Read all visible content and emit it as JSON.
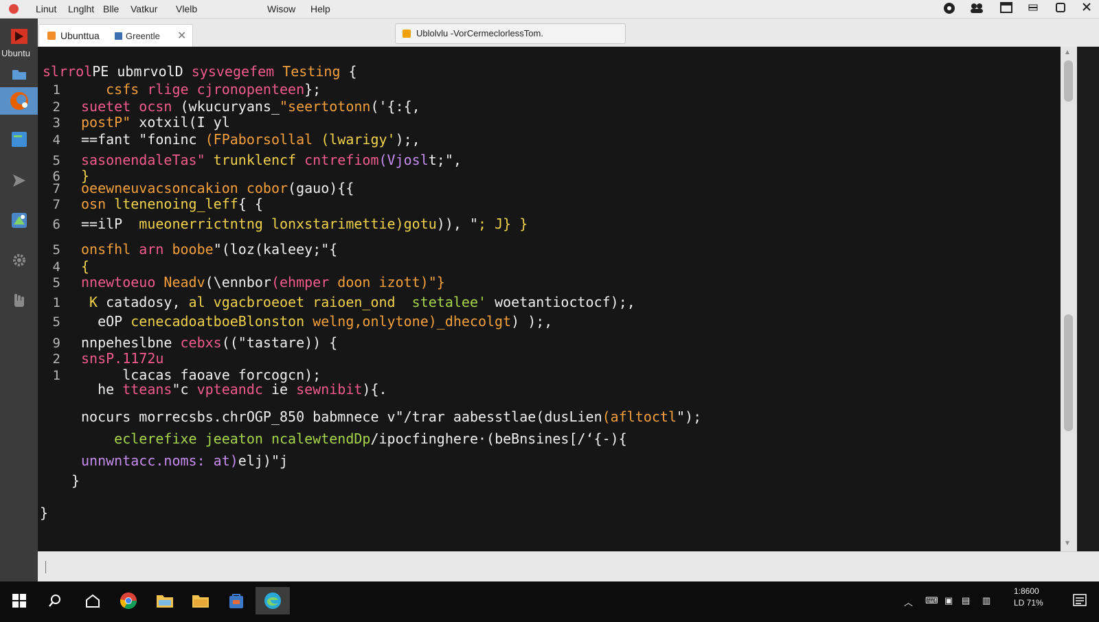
{
  "menubar": {
    "items": [
      "Linut",
      "Lnglht",
      "Blle",
      "Vatkur",
      "Vlelb",
      "Wisow",
      "Help"
    ]
  },
  "sidebar": {
    "label": "Ubuntu",
    "items": [
      "ubuntu-logo",
      "files-icon",
      "firefox-icon",
      "document-icon",
      "send-icon",
      "maps-icon",
      "settings-icon",
      "hand-icon"
    ]
  },
  "tabs": {
    "tab1_title": "Ubunttua",
    "tab1_sub": "Greentle",
    "tab2_title": "Ublolvlu -VorCermeclorlessTom."
  },
  "editor": {
    "lines": [
      {
        "num": "",
        "parts": [
          {
            "t": "slrrol",
            "c": "pink"
          },
          {
            "t": "PE ubmrvolD ",
            "c": "white"
          },
          {
            "t": "sysvegefem ",
            "c": "pink"
          },
          {
            "t": "Testing ",
            "c": "orange"
          },
          {
            "t": "{",
            "c": "white"
          }
        ]
      },
      {
        "num": "1",
        "parts": [
          {
            "t": "   ",
            "c": "white"
          },
          {
            "t": "csfs ",
            "c": "orange"
          },
          {
            "t": "rlige ",
            "c": "pink"
          },
          {
            "t": "cjronopenteen",
            "c": "pink"
          },
          {
            "t": "};",
            "c": "white"
          }
        ]
      },
      {
        "num": "2",
        "parts": [
          {
            "t": "suetet ocsn ",
            "c": "pink"
          },
          {
            "t": "(wkucuryans_",
            "c": "white"
          },
          {
            "t": "\"seertotonn",
            "c": "orange"
          },
          {
            "t": "('{:{,",
            "c": "white"
          }
        ]
      },
      {
        "num": "3",
        "parts": [
          {
            "t": "postP\" ",
            "c": "orange"
          },
          {
            "t": "xotxil(I yl",
            "c": "white"
          }
        ]
      },
      {
        "num": "4",
        "parts": [
          {
            "t": "==fant ",
            "c": "white"
          },
          {
            "t": "\"foninc ",
            "c": "white"
          },
          {
            "t": "(FPaborsollal ",
            "c": "orange"
          },
          {
            "t": "(lwarigy'",
            "c": "yellow"
          },
          {
            "t": ");,",
            "c": "white"
          }
        ]
      },
      {
        "num": "5",
        "parts": [
          {
            "t": "sasonendaleTas\" ",
            "c": "pink"
          },
          {
            "t": "trunklencf ",
            "c": "yellow"
          },
          {
            "t": "cntrefiom",
            "c": "pink"
          },
          {
            "t": "(Vjosl",
            "c": "violet"
          },
          {
            "t": "t;\",",
            "c": "white"
          }
        ]
      },
      {
        "num": "6",
        "parts": [
          {
            "t": "}",
            "c": "yellow"
          }
        ]
      },
      {
        "num": "7",
        "parts": [
          {
            "t": "oeewneuvacsoncakion ",
            "c": "orange"
          },
          {
            "t": "cobor",
            "c": "orange"
          },
          {
            "t": "(gauo){{",
            "c": "white"
          }
        ]
      },
      {
        "num": "7",
        "parts": [
          {
            "t": "osn ",
            "c": "orange"
          },
          {
            "t": "ltenenoing_leff",
            "c": "yellow"
          },
          {
            "t": "{ {",
            "c": "white"
          }
        ]
      },
      {
        "num": "6",
        "parts": [
          {
            "t": "==ilP  ",
            "c": "white"
          },
          {
            "t": "mueonerrictntng ",
            "c": "yellow"
          },
          {
            "t": "lonxstarimettie)gotu",
            "c": "yellow"
          },
          {
            "t": ")), \"",
            "c": "white"
          },
          {
            "t": "; J} }",
            "c": "yellow"
          }
        ]
      },
      {
        "num": "5",
        "parts": [
          {
            "t": "onsfhl ",
            "c": "orange"
          },
          {
            "t": "arn ",
            "c": "pink"
          },
          {
            "t": "boobe",
            "c": "orange"
          },
          {
            "t": "\"(loz(kaleey",
            "c": "white"
          },
          {
            "t": ";\"{",
            "c": "white"
          }
        ]
      },
      {
        "num": "4",
        "parts": [
          {
            "t": "{",
            "c": "yellow"
          }
        ]
      },
      {
        "num": "5",
        "parts": [
          {
            "t": "nnewtoeuo ",
            "c": "pink"
          },
          {
            "t": "Neadv",
            "c": "orange"
          },
          {
            "t": "(\\ennbor",
            "c": "white"
          },
          {
            "t": "(ehmper ",
            "c": "pink"
          },
          {
            "t": "doon izott)\"}",
            "c": "orange"
          }
        ]
      },
      {
        "num": "1",
        "parts": [
          {
            "t": " K ",
            "c": "yellow"
          },
          {
            "t": "catadosy, ",
            "c": "white"
          },
          {
            "t": "al vgacbroeoet ",
            "c": "yellow"
          },
          {
            "t": "raioen_ond  ",
            "c": "yellow"
          },
          {
            "t": "stetalee' ",
            "c": "green"
          },
          {
            "t": "woetantioctocf);,",
            "c": "white"
          }
        ]
      },
      {
        "num": "5",
        "parts": [
          {
            "t": "  eOP ",
            "c": "white"
          },
          {
            "t": "cenecadoatboeBlonston ",
            "c": "yellow"
          },
          {
            "t": "welng,onlytone)_dhecolgt",
            "c": "orange"
          },
          {
            "t": ") );,",
            "c": "white"
          }
        ]
      },
      {
        "num": "9",
        "parts": [
          {
            "t": "nnpeheslbne ",
            "c": "white"
          },
          {
            "t": "cebxs",
            "c": "pink"
          },
          {
            "t": "((\"tastare)) {",
            "c": "white"
          }
        ]
      },
      {
        "num": "2",
        "parts": [
          {
            "t": "snsP.1172u",
            "c": "pink"
          }
        ]
      },
      {
        "num": "1",
        "parts": [
          {
            "t": "     lcacas faoave forcogcn);",
            "c": "white"
          }
        ]
      },
      {
        "num": "",
        "parts": [
          {
            "t": "  he ",
            "c": "white"
          },
          {
            "t": "tteans",
            "c": "pink"
          },
          {
            "t": "\"c ",
            "c": "white"
          },
          {
            "t": "vpteandc ",
            "c": "pink"
          },
          {
            "t": "ie ",
            "c": "white"
          },
          {
            "t": "sewnibit",
            "c": "pink"
          },
          {
            "t": "){.",
            "c": "white"
          }
        ]
      },
      {
        "num": "",
        "parts": [
          {
            "t": "nocurs ",
            "c": "white"
          },
          {
            "t": "morrecsbs.chrOGP_850 ",
            "c": "white"
          },
          {
            "t": "babmnece v",
            "c": "white"
          },
          {
            "t": "\"/trar ",
            "c": "white"
          },
          {
            "t": "aabesstlae(dusLien",
            "c": "white"
          },
          {
            "t": "(afltoctl",
            "c": "orange"
          },
          {
            "t": "\");",
            "c": "white"
          }
        ]
      },
      {
        "num": "",
        "parts": [
          {
            "t": "    ",
            "c": "white"
          },
          {
            "t": "eclerefixe ",
            "c": "green"
          },
          {
            "t": "jeeaton ",
            "c": "green"
          },
          {
            "t": "ncalewtendDp",
            "c": "green"
          },
          {
            "t": "/ipocfinghere·(beBnsines[/‘{-){",
            "c": "white"
          }
        ]
      },
      {
        "num": "",
        "parts": [
          {
            "t": "unnwntacc.noms: ",
            "c": "violet"
          },
          {
            "t": "at)",
            "c": "violet"
          },
          {
            "t": "elj",
            "c": "white"
          },
          {
            "t": ")\"j",
            "c": "white"
          }
        ]
      },
      {
        "num": "",
        "parts": [
          {
            "t": "}",
            "c": "white"
          }
        ]
      },
      {
        "num": "",
        "parts": [
          {
            "t": "}",
            "c": "white"
          }
        ]
      }
    ]
  },
  "colors": {
    "pink": "#f45b8c",
    "orange": "#f6a03c",
    "yellow": "#f2d24a",
    "green": "#a8d64a",
    "violet": "#c78cf0",
    "white": "#f0f0f0"
  },
  "taskbar": {
    "apps": [
      "windows-start-icon",
      "search-icon",
      "task-view-icon",
      "chrome-icon",
      "file-explorer-icon",
      "folder-icon",
      "store-icon",
      "edge-icon"
    ],
    "clock_time": "1:8600",
    "clock_date": "LD 71%"
  }
}
